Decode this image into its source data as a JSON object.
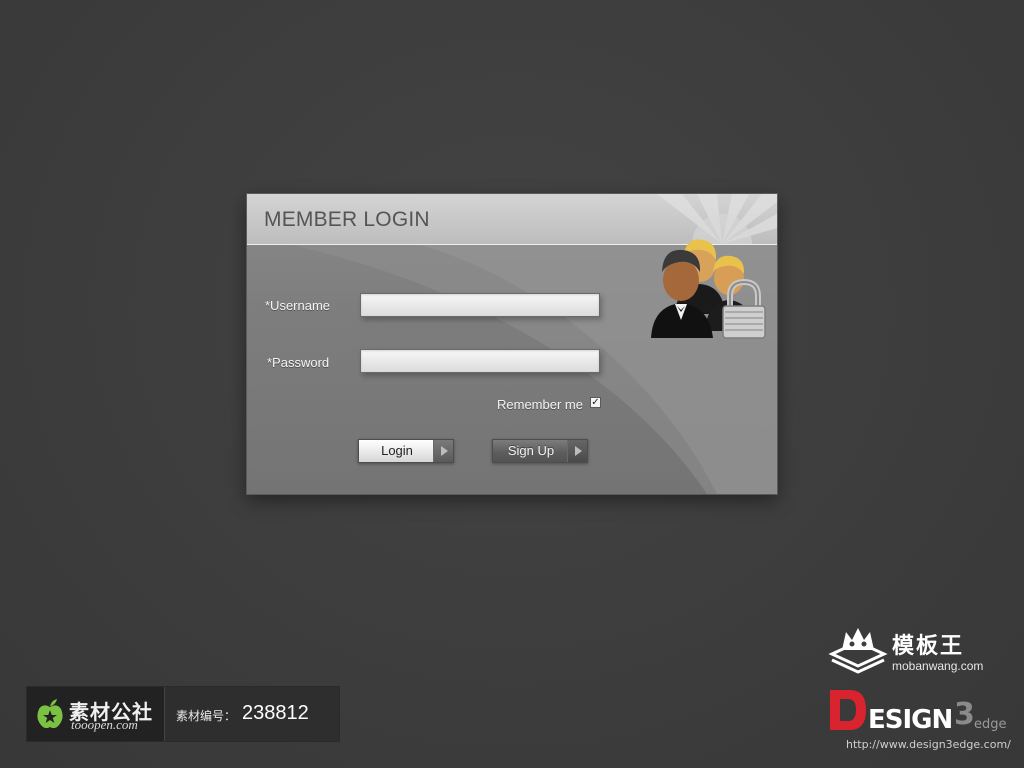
{
  "login": {
    "title": "MEMBER LOGIN",
    "username_label": "*Username",
    "username_value": "",
    "password_label": "*Password",
    "password_value": "",
    "remember_label": "Remember me",
    "remember_checked": true,
    "remember_mark": "✓",
    "login_button": "Login",
    "signup_button": "Sign Up",
    "icon": "users-lock-icon"
  },
  "badge": {
    "brand_cn": "素材公社",
    "brand_en": "tooopen.com",
    "number_label": "素材编号：",
    "number_value": "238812",
    "icon": "apple-star-icon"
  },
  "watermarks": {
    "mobanwang_title": "模板王",
    "mobanwang_url": "mobanwang.com",
    "design3edge_logo_text": "DESIGN3edge",
    "design3edge_url": "http://www.design3edge.com/"
  },
  "colors": {
    "background": "#3e3e3e",
    "panel": "#7d7d7d",
    "header": "#c8c8c8",
    "title_text": "#555555",
    "design3_red": "#d9232e"
  }
}
